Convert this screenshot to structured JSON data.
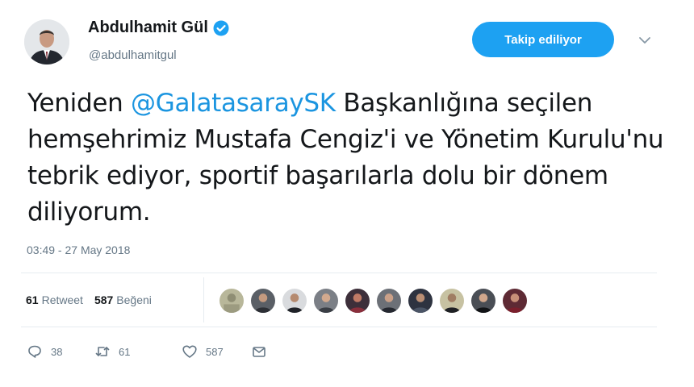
{
  "user": {
    "display_name": "Abdulhamit Gül",
    "handle": "@abdulhamitgul"
  },
  "follow_button": {
    "label": "Takip ediliyor"
  },
  "tweet": {
    "text_segments": [
      {
        "text": "Yeniden ",
        "type": "plain"
      },
      {
        "text": "@GalatasaraySK",
        "type": "mention"
      },
      {
        "text": " Başkanlığına seçilen hemşehrimiz Mustafa Cengiz'i ve Yönetim Kurulu'nu tebrik ediyor, sportif başarılarla dolu bir dönem diliyorum.",
        "type": "plain"
      }
    ],
    "timestamp": "03:49 - 27 May 2018"
  },
  "stats": {
    "retweet_count": "61",
    "retweet_label": "Retweet",
    "like_count": "587",
    "like_label": "Beğeni"
  },
  "actions": {
    "reply_count": "38",
    "retweet_count": "61",
    "like_count": "587"
  },
  "icons": {
    "verified": "verified-badge-icon",
    "caret": "chevron-down-icon",
    "reply": "reply-icon",
    "retweet": "retweet-icon",
    "like": "heart-icon",
    "message": "envelope-icon"
  },
  "colors": {
    "accent": "#1da1f2",
    "mention": "#1b95e0",
    "secondary_text": "#657786",
    "primary_text": "#14171a"
  }
}
